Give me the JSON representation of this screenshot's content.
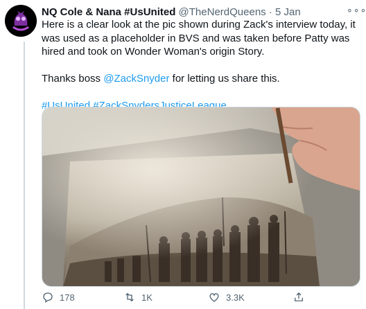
{
  "tweet": {
    "author_name": "NQ Cole & Nana #UsUnited",
    "handle": "@TheNerdQueens",
    "separator": "·",
    "date": "5 Jan",
    "more_glyph": "∘∘∘",
    "text_line1": "Here is a clear look at the pic shown during Zack's interview today, it was used as a placeholder in BVS and was taken before Patty was hired and took on Wonder Woman's origin Story.",
    "thanks_prefix": "Thanks boss ",
    "mention": "@ZackSnyder",
    "thanks_suffix": " for letting us share this.",
    "hashtag1": "#UsUnited",
    "hashtag2": "#ZackSnydersJusticeLeague"
  },
  "media": {
    "icon": "photo-of-tintype-photograph"
  },
  "actions": {
    "reply_count": "178",
    "retweet_count": "1K",
    "like_count": "3.3K"
  },
  "colors": {
    "link": "#1d9bf0",
    "secondary_text": "#536471",
    "avatar_accent": "#b64fd6"
  }
}
